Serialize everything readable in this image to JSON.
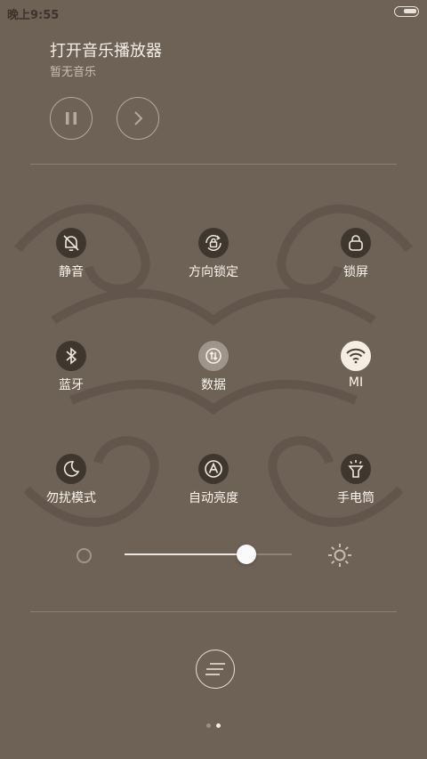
{
  "statusbar": {
    "time": "晚上9:55"
  },
  "music": {
    "title": "打开音乐播放器",
    "subtitle": "暂无音乐"
  },
  "toggles": [
    {
      "label": "静音",
      "icon": "bell-off-icon",
      "state": "off"
    },
    {
      "label": "方向锁定",
      "icon": "rotation-lock-icon",
      "state": "off"
    },
    {
      "label": "锁屏",
      "icon": "lock-icon",
      "state": "off"
    },
    {
      "label": "蓝牙",
      "icon": "bluetooth-icon",
      "state": "off"
    },
    {
      "label": "数据",
      "icon": "mobile-data-icon",
      "state": "partial"
    },
    {
      "label": "MI",
      "icon": "wifi-icon",
      "state": "on"
    },
    {
      "label": "勿扰模式",
      "icon": "moon-icon",
      "state": "off"
    },
    {
      "label": "自动亮度",
      "icon": "auto-brightness-icon",
      "state": "off"
    },
    {
      "label": "手电筒",
      "icon": "flashlight-icon",
      "state": "off"
    }
  ],
  "brightness": {
    "level": 0.73
  },
  "pager": {
    "pages": 2,
    "current": 2
  },
  "colors": {
    "background": "#6e6257",
    "icon_bg_off": "#3f362e",
    "icon_bg_on": "#f5ede2",
    "text": "#f3ece4"
  }
}
